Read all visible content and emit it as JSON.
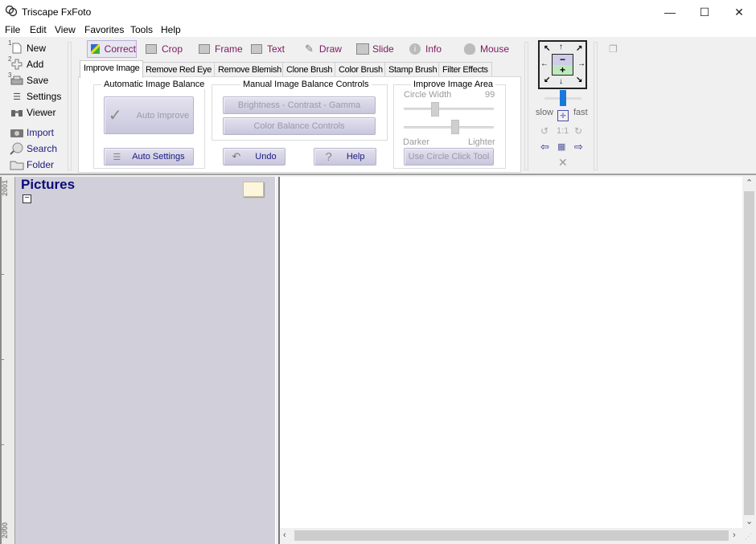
{
  "window": {
    "title": "Triscape FxFoto",
    "controls": {
      "minimize": "—",
      "maximize": "☐",
      "close": "✕"
    }
  },
  "menu": [
    "File",
    "Edit",
    "View",
    "Favorites",
    "Tools",
    "Help"
  ],
  "left_toolbar": [
    {
      "num": "1",
      "label": "New",
      "icon": "new-document-icon"
    },
    {
      "num": "2",
      "label": "Add",
      "icon": "add-icon"
    },
    {
      "num": "3",
      "label": "Save",
      "icon": "save-icon"
    },
    {
      "num": "",
      "label": "Settings",
      "icon": "list-icon"
    },
    {
      "num": "",
      "label": "Viewer",
      "icon": "binoculars-icon"
    },
    {
      "num": "",
      "label": "Import",
      "icon": "camera-icon"
    },
    {
      "num": "",
      "label": "Search",
      "icon": "magnifier-icon"
    },
    {
      "num": "",
      "label": "Folder",
      "icon": "folder-icon"
    }
  ],
  "mode_toolbar": [
    {
      "label": "Correct",
      "active": true
    },
    {
      "label": "Crop"
    },
    {
      "label": "Frame"
    },
    {
      "label": "Text"
    },
    {
      "label": "Draw"
    },
    {
      "label": "Slide"
    },
    {
      "label": "Info"
    },
    {
      "label": "Mouse"
    }
  ],
  "tabs": [
    "Improve Image",
    "Remove Red Eye",
    "Remove Blemish",
    "Clone Brush",
    "Color Brush",
    "Stamp Brush",
    "Filter Effects"
  ],
  "active_tab": "Improve Image",
  "improve": {
    "auto_group_label": "Automatic Image Balance",
    "auto_improve": "Auto Improve",
    "auto_settings": "Auto Settings",
    "manual_group_label": "Manual Image Balance Controls",
    "bcg": "Brightness - Contrast - Gamma",
    "color_balance": "Color Balance Controls",
    "undo": "Undo",
    "help": "Help",
    "area_group_label": "Improve Image Area",
    "circle_width_label": "Circle Width",
    "circle_width_value": "99",
    "circle_width_fraction": 0.33,
    "brightness_fraction": 0.58,
    "darker": "Darker",
    "lighter": "Lighter",
    "circle_tool": "Use Circle Click Tool"
  },
  "navigation": {
    "speed_slow": "slow",
    "speed_fast": "fast",
    "speed_fraction": 0.5,
    "one_to_one": "1:1"
  },
  "albums": {
    "title": "Pictures",
    "collapse": "−"
  },
  "timeline": {
    "top_year": "2001",
    "bottom_year": "2000"
  }
}
